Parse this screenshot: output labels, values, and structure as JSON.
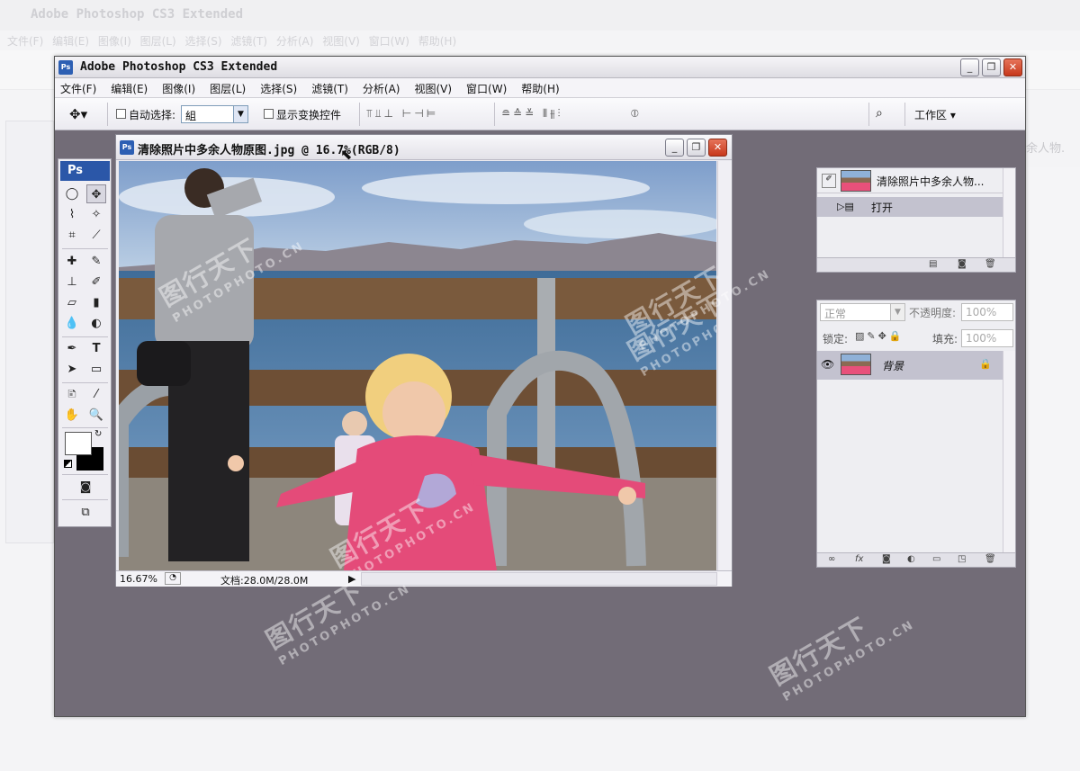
{
  "background_app": {
    "title": "Adobe Photoshop CS3 Extended",
    "menu": [
      "文件(F)",
      "编辑(E)",
      "图像(I)",
      "图层(L)",
      "选择(S)",
      "滤镜(T)",
      "分析(A)",
      "视图(V)",
      "窗口(W)",
      "帮助(H)"
    ],
    "right_fragment": "余人物."
  },
  "window": {
    "title": "Adobe Photoshop CS3 Extended",
    "controls": {
      "minimize": "_",
      "restore": "❐",
      "close": "✕"
    }
  },
  "menubar": [
    "文件(F)",
    "编辑(E)",
    "图像(I)",
    "图层(L)",
    "选择(S)",
    "滤镜(T)",
    "分析(A)",
    "视图(V)",
    "窗口(W)",
    "帮助(H)"
  ],
  "options_bar": {
    "auto_select_label": "自动选择:",
    "auto_select_value": "組",
    "show_transform_label": "显示变换控件",
    "workspace_label": "工作区 ▾"
  },
  "tools_panel": {
    "logo": "Ps",
    "tools": [
      "ellipse-marquee",
      "move",
      "lasso",
      "magic-wand",
      "crop",
      "slice",
      "healing",
      "brush",
      "stamp",
      "history-brush",
      "eraser",
      "gradient",
      "blur",
      "dodge",
      "pen",
      "type",
      "path-select",
      "shape",
      "notes",
      "eyedropper",
      "hand",
      "zoom"
    ]
  },
  "document": {
    "title": "清除照片中多余人物原图.jpg @ 16.7%(RGB/8)",
    "zoom": "16.67%",
    "doc_size": "文档:28.0M/28.0M"
  },
  "history_panel": {
    "snapshot_name": "清除照片中多余人物...",
    "item": "打开"
  },
  "layers_panel": {
    "blend_mode": "正常",
    "opacity_label": "不透明度:",
    "opacity_value": "100%",
    "lock_label": "锁定:",
    "fill_label": "填充:",
    "fill_value": "100%",
    "layer_name": "背景"
  },
  "watermark": {
    "text": "图行天下",
    "sub": "PHOTOPHOTO.CN"
  },
  "colors": {
    "workspace": "#726c77",
    "accent": "#2b57a8",
    "close": "#c7381c"
  }
}
